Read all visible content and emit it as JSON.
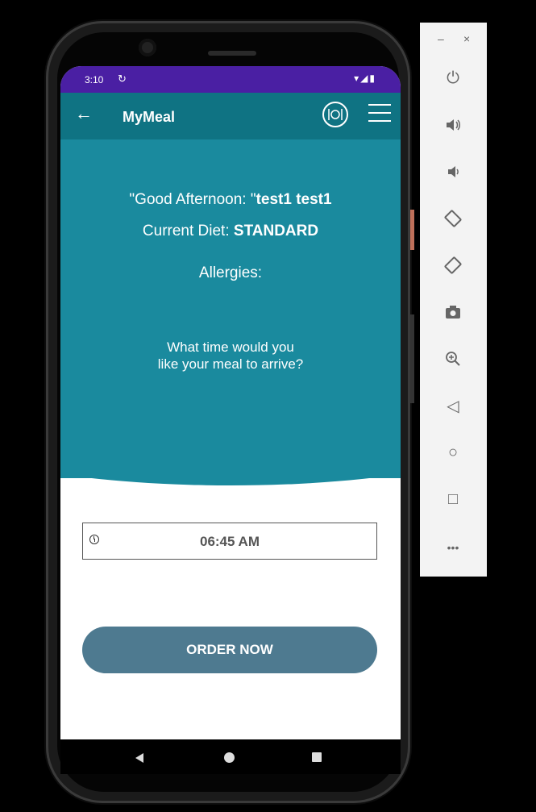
{
  "status_bar": {
    "time": "3:10",
    "sync_icon": "sync-icon",
    "signal_icons": "▾◢▮"
  },
  "app_bar": {
    "title": "MyMeal",
    "back_icon": "arrow-left-icon",
    "meal_icon": "plate-fork-knife-icon",
    "menu_icon": "hamburger-menu-icon"
  },
  "hero": {
    "greeting_prefix": "\"Good Afternoon: \"",
    "user_name": "test1 test1",
    "diet_label": "Current Diet: ",
    "diet_value": "STANDARD",
    "allergies_label": "Allergies:",
    "question_line1": "What time would you",
    "question_line2": "like your meal to arrive?"
  },
  "time_picker": {
    "value": "06:45 AM",
    "icon": "clock-icon"
  },
  "order_button": {
    "label": "ORDER NOW"
  },
  "emulator_panel": {
    "minimize": "–",
    "close": "×",
    "buttons": [
      {
        "name": "power-icon",
        "glyph": "⏻"
      },
      {
        "name": "volume-up-icon",
        "glyph": "🔊"
      },
      {
        "name": "volume-down-icon",
        "glyph": "🔉"
      },
      {
        "name": "rotate-left-icon",
        "glyph": "⟲"
      },
      {
        "name": "rotate-right-icon",
        "glyph": "⟳"
      },
      {
        "name": "camera-icon",
        "glyph": "📷"
      },
      {
        "name": "zoom-icon",
        "glyph": "⊕"
      },
      {
        "name": "back-icon",
        "glyph": "◁"
      },
      {
        "name": "home-icon",
        "glyph": "○"
      },
      {
        "name": "overview-icon",
        "glyph": "□"
      },
      {
        "name": "more-icon",
        "glyph": "•••"
      }
    ]
  },
  "colors": {
    "status_bar": "#4a1fa3",
    "app_bar": "#0f7383",
    "hero": "#1a8a9e",
    "order_button": "#4e7a90"
  }
}
